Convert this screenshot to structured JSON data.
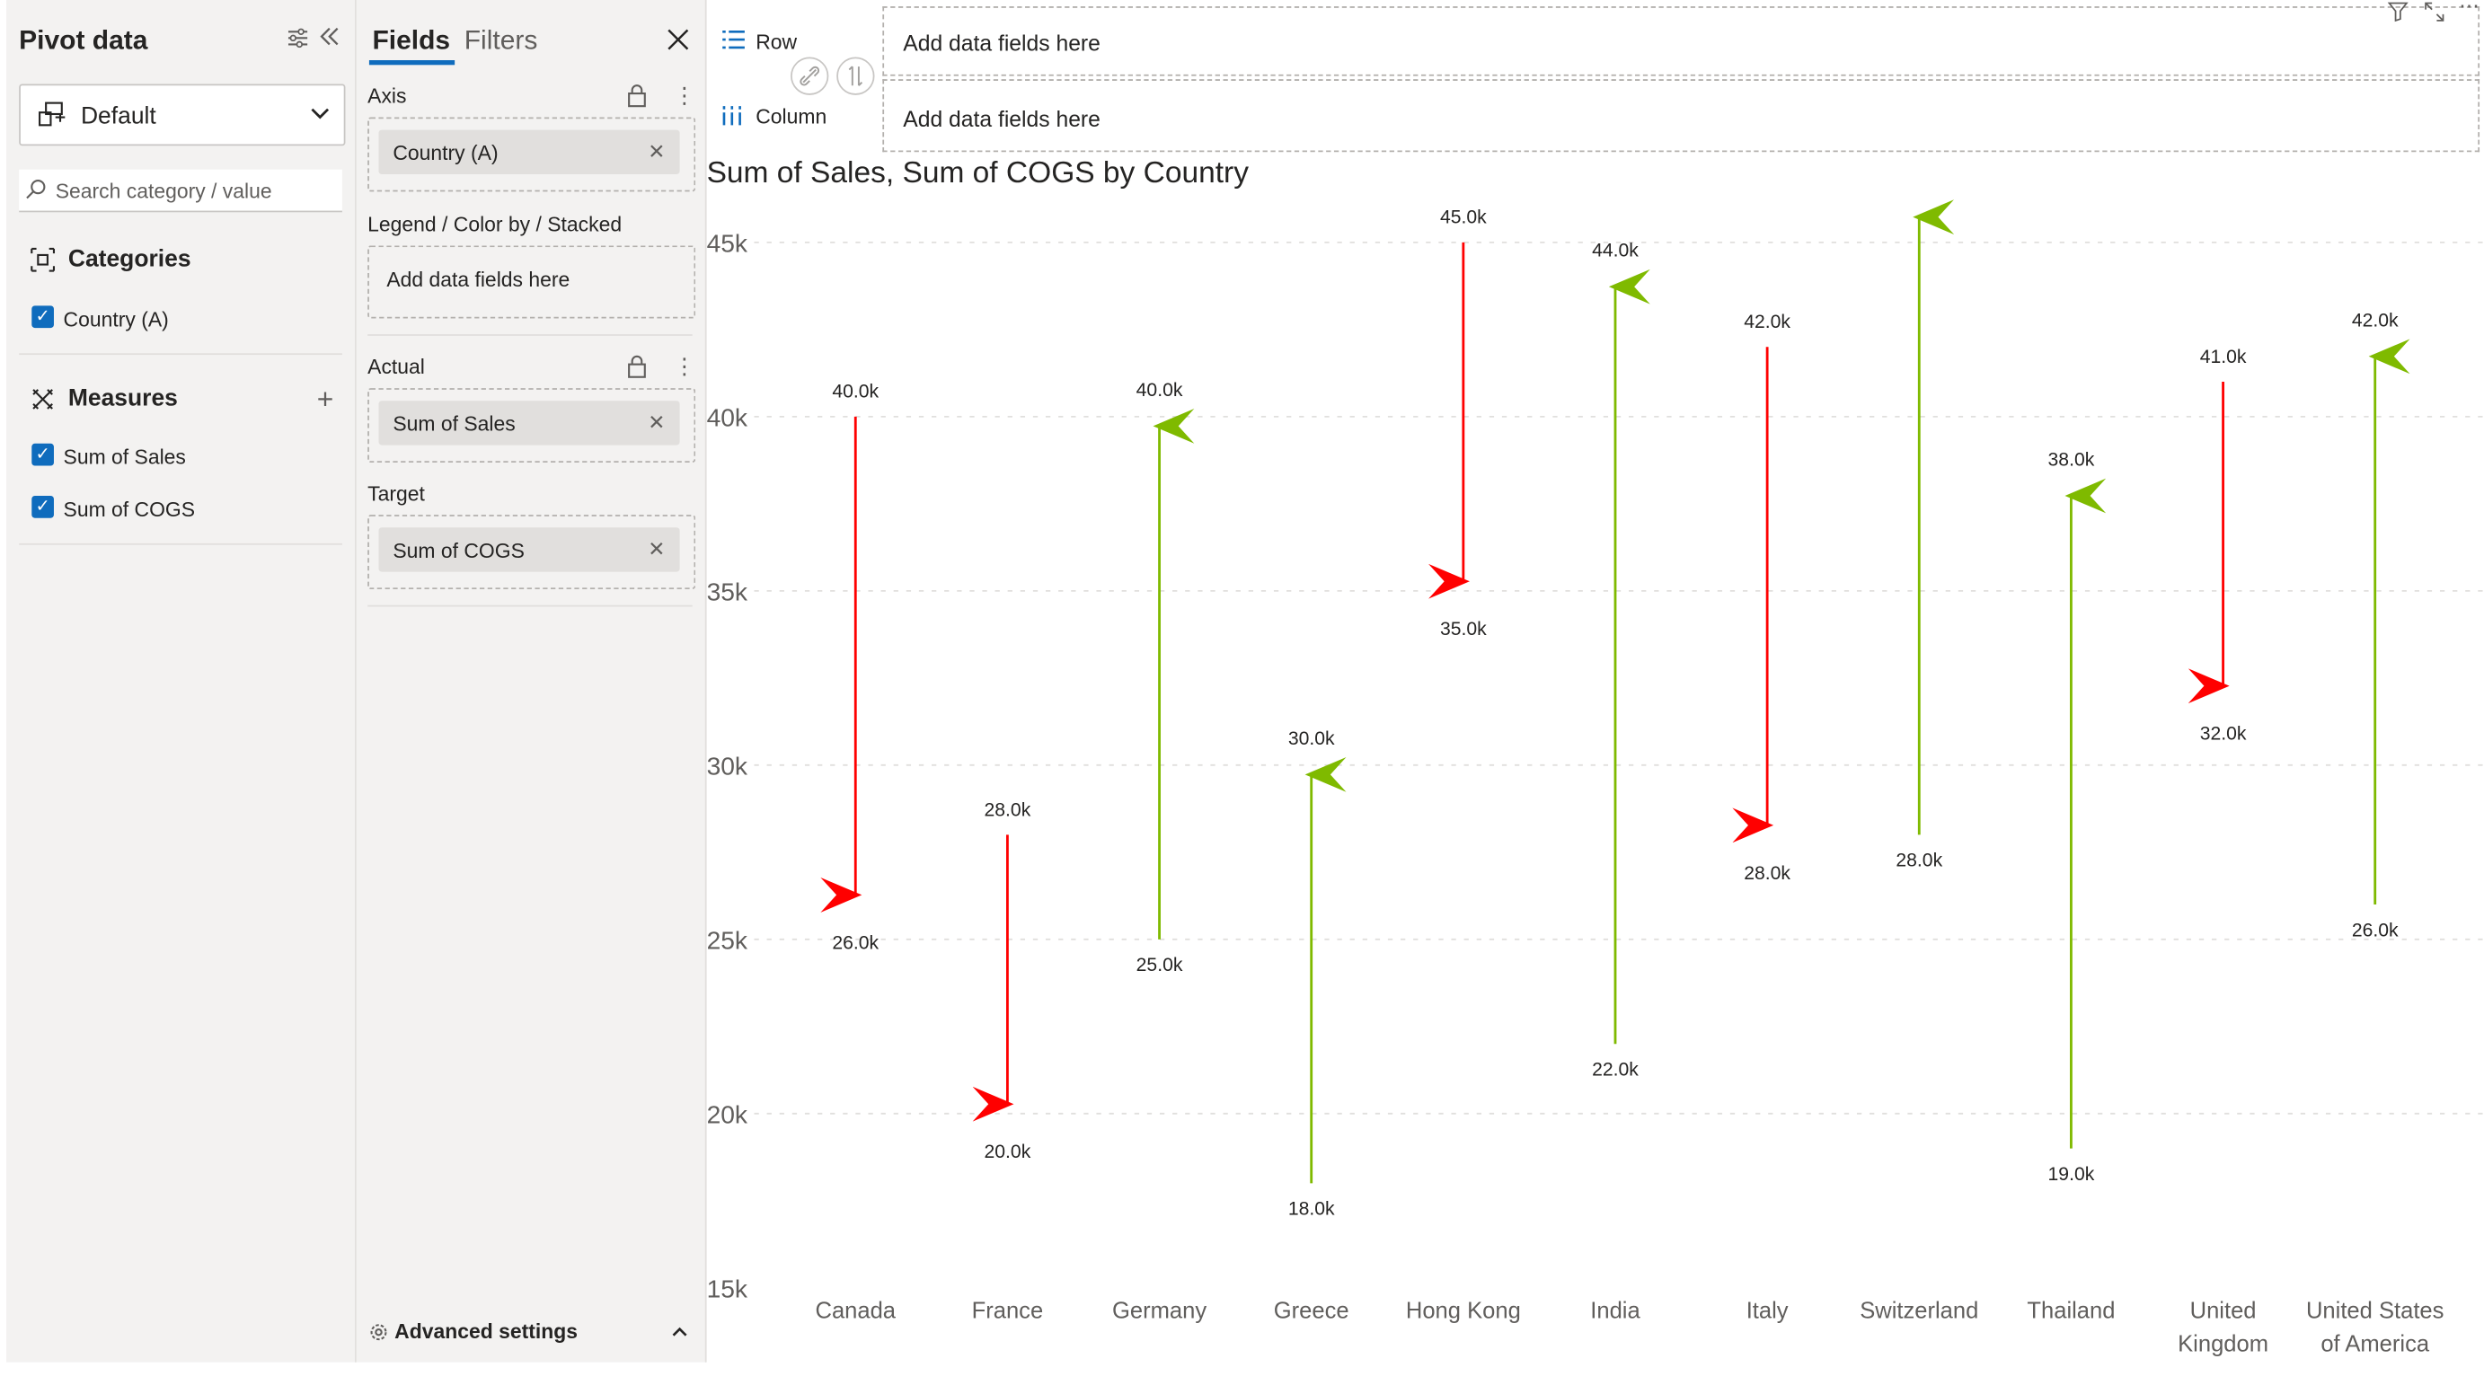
{
  "pivot": {
    "title": "Pivot data",
    "preset": "Default",
    "search_placeholder": "Search category / value",
    "categories_title": "Categories",
    "categories": [
      "Country (A)"
    ],
    "measures_title": "Measures",
    "measures": [
      "Sum of Sales",
      "Sum of COGS"
    ]
  },
  "fields": {
    "tab_fields": "Fields",
    "tab_filters": "Filters",
    "axis_label": "Axis",
    "axis_chip": "Country (A)",
    "legend_label": "Legend / Color by / Stacked",
    "legend_placeholder": "Add data fields here",
    "actual_label": "Actual",
    "actual_chip": "Sum of Sales",
    "target_label": "Target",
    "target_chip": "Sum of COGS",
    "advanced": "Advanced settings"
  },
  "toolbar": {
    "row_label": "Row",
    "column_label": "Column",
    "row_placeholder": "Add data fields here",
    "column_placeholder": "Add data fields here"
  },
  "colors": {
    "increase": "#7fba00",
    "decrease": "#ff0000",
    "accent": "#0f6cbd"
  },
  "chart_data": {
    "type": "arrow",
    "title": "Sum of Sales, Sum of COGS by Country",
    "categories": [
      "Canada",
      "France",
      "Germany",
      "Greece",
      "Hong Kong",
      "India",
      "Italy",
      "Switzerland",
      "Thailand",
      "United Kingdom",
      "United States of America"
    ],
    "category_lines": [
      [
        "Canada"
      ],
      [
        "France"
      ],
      [
        "Germany"
      ],
      [
        "Greece"
      ],
      [
        "Hong Kong"
      ],
      [
        "India"
      ],
      [
        "Italy"
      ],
      [
        "Switzerland"
      ],
      [
        "Thailand"
      ],
      [
        "United",
        "Kingdom"
      ],
      [
        "United States",
        "of America"
      ]
    ],
    "series": [
      {
        "name": "Sum of Sales",
        "values": [
          40000,
          28000,
          25000,
          18000,
          45000,
          22000,
          42000,
          28000,
          19000,
          41000,
          26000
        ]
      },
      {
        "name": "Sum of COGS",
        "values": [
          26000,
          20000,
          40000,
          30000,
          35000,
          44000,
          28000,
          46000,
          38000,
          32000,
          42000
        ]
      }
    ],
    "start_labels": [
      "40.0k",
      "28.0k",
      "25.0k",
      "18.0k",
      "45.0k",
      "22.0k",
      "42.0k",
      "28.0k",
      "19.0k",
      "41.0k",
      "26.0k"
    ],
    "end_labels": [
      "26.0k",
      "20.0k",
      "40.0k",
      "30.0k",
      "35.0k",
      "44.0k",
      "28.0k",
      "",
      "38.0k",
      "32.0k",
      "42.0k"
    ],
    "y_ticks": [
      15000,
      20000,
      25000,
      30000,
      35000,
      40000,
      45000
    ],
    "y_tick_labels": [
      "15k",
      "20k",
      "25k",
      "30k",
      "35k",
      "40k",
      "45k"
    ],
    "ylim": [
      15000,
      45000
    ],
    "grid": true
  }
}
